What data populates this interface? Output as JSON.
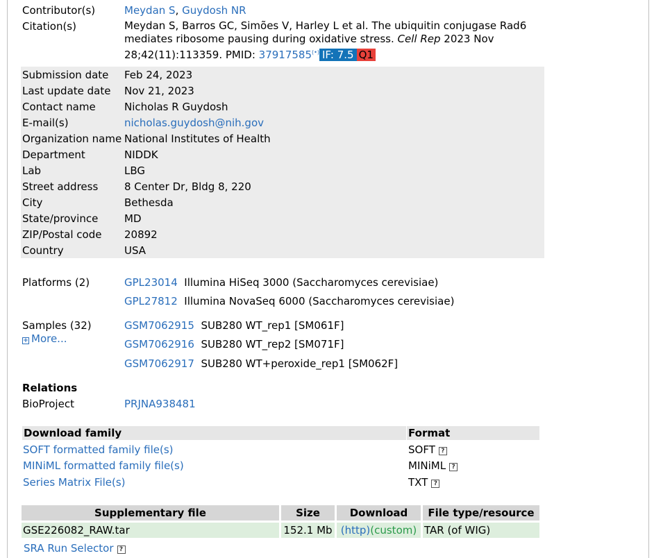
{
  "contributors": {
    "label": "Contributor(s)",
    "names": [
      "Meydan S",
      "Guydosh NR"
    ],
    "separator": ", "
  },
  "citation": {
    "label": "Citation(s)",
    "text": "Meydan S, Barros GC, Simões V, Harley L et al. The ubiquitin conjugase Rad6 mediates ribosome pausing during oxidative stress. ",
    "journal": "Cell Rep",
    "details": " 2023 Nov 28;42(11):113359. PMID: ",
    "pmid": "37917585",
    "pmid_sup": "(•)",
    "impact_factor": "IF: 7.5",
    "quartile": "Q1"
  },
  "details": [
    {
      "label": "Submission date",
      "value": "Feb 24, 2023"
    },
    {
      "label": "Last update date",
      "value": "Nov 21, 2023"
    },
    {
      "label": "Contact name",
      "value": "Nicholas R Guydosh"
    },
    {
      "label": "E-mail(s)",
      "value": "nicholas.guydosh@nih.gov"
    },
    {
      "label": "Organization name",
      "value": "National Institutes of Health"
    },
    {
      "label": "Department",
      "value": "NIDDK"
    },
    {
      "label": "Lab",
      "value": "LBG"
    },
    {
      "label": "Street address",
      "value": "8 Center Dr, Bldg 8, 220"
    },
    {
      "label": "City",
      "value": "Bethesda"
    },
    {
      "label": "State/province",
      "value": "MD"
    },
    {
      "label": "ZIP/Postal code",
      "value": "20892"
    },
    {
      "label": "Country",
      "value": "USA"
    }
  ],
  "platforms": {
    "label": "Platforms (2)",
    "items": [
      {
        "id": "GPL23014",
        "desc": "Illumina HiSeq 3000 (Saccharomyces cerevisiae)"
      },
      {
        "id": "GPL27812",
        "desc": "Illumina NovaSeq 6000 (Saccharomyces cerevisiae)"
      }
    ]
  },
  "samples": {
    "label": "Samples (32)",
    "more": "More...",
    "items": [
      {
        "id": "GSM7062915",
        "desc": "SUB280 WT_rep1 [SM061F]"
      },
      {
        "id": "GSM7062916",
        "desc": "SUB280 WT_rep2 [SM071F]"
      },
      {
        "id": "GSM7062917",
        "desc": "SUB280 WT+peroxide_rep1 [SM062F]"
      }
    ]
  },
  "relations": {
    "heading": "Relations",
    "bioproject_label": "BioProject",
    "bioproject_id": "PRJNA938481"
  },
  "download_family": {
    "header": "Download family",
    "format_header": "Format",
    "help_glyph": "?",
    "rows": [
      {
        "name": "SOFT formatted family file(s)",
        "format": "SOFT"
      },
      {
        "name": "MINiML formatted family file(s)",
        "format": "MINiML"
      },
      {
        "name": "Series Matrix File(s)",
        "format": "TXT"
      }
    ]
  },
  "supplementary": {
    "headers": [
      "Supplementary file",
      "Size",
      "Download",
      "File type/resource"
    ],
    "rows": [
      {
        "file": "GSE226082_RAW.tar",
        "size": "152.1 Mb",
        "http": "(http)",
        "custom": "(custom)",
        "type": "TAR (of WIG)"
      }
    ],
    "sra_selector": "SRA Run Selector",
    "help_glyph": "?"
  },
  "colors": {
    "link": "#2a6ebb",
    "impact_badge": "#1373b8",
    "quartile_badge": "#e8413a",
    "custom_link": "#2a9a4a"
  }
}
